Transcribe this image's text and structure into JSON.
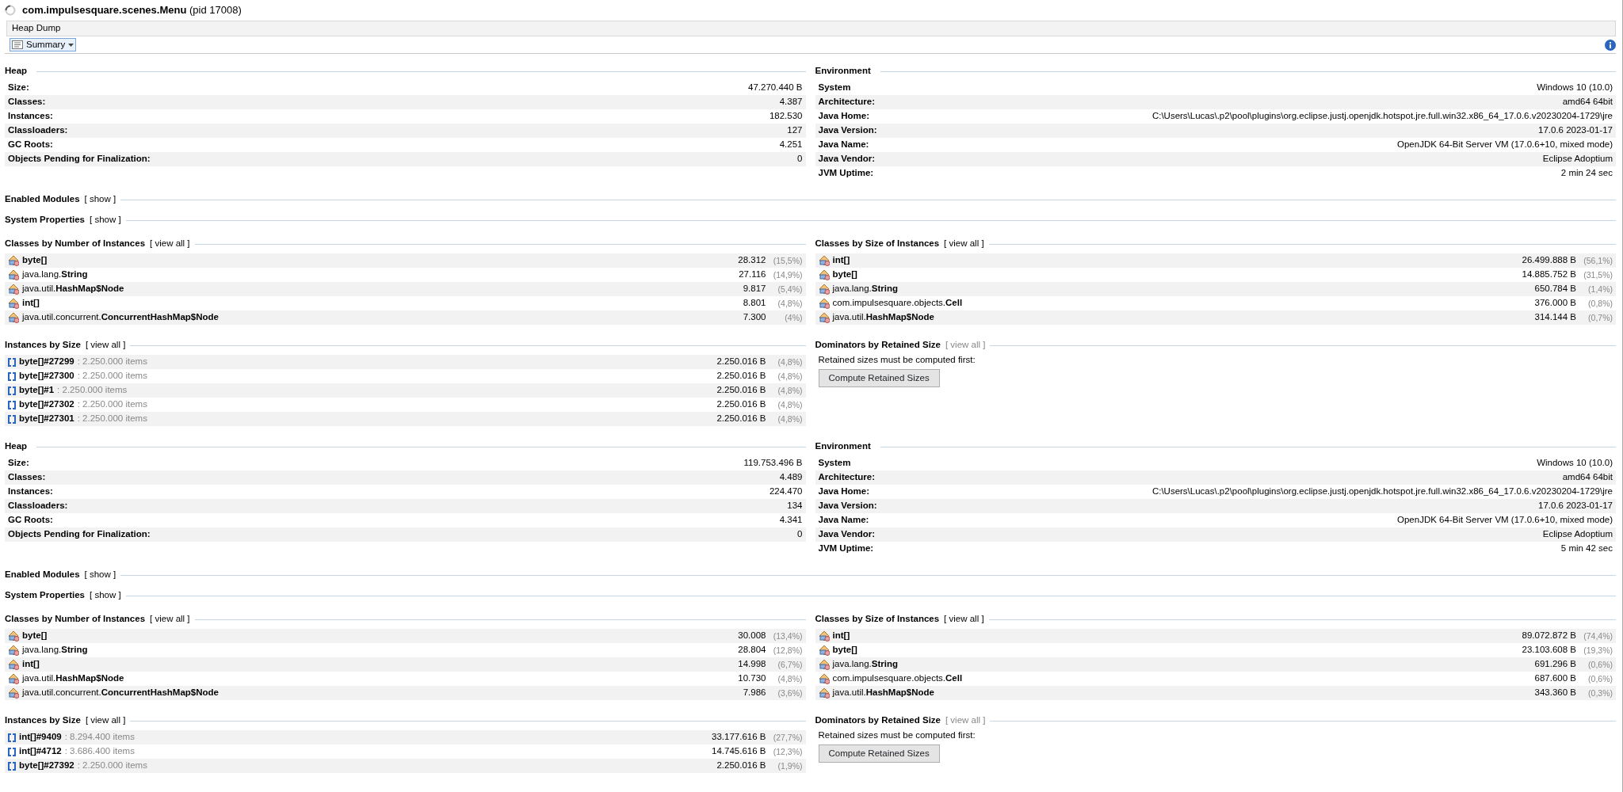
{
  "window": {
    "title": "**com.impulsesquare.scenes.Menu** (pid 17008)"
  },
  "tab": {
    "label": "Heap Dump"
  },
  "view_selector": {
    "label": "Summary"
  },
  "dumps": [
    {
      "heap": {
        "title": "Heap",
        "rows": [
          {
            "label": "Size:",
            "value": "47.270.440 B"
          },
          {
            "label": "Classes:",
            "value": "4.387"
          },
          {
            "label": "Instances:",
            "value": "182.530"
          },
          {
            "label": "Classloaders:",
            "value": "127"
          },
          {
            "label": "GC Roots:",
            "value": "4.251"
          },
          {
            "label": "Objects Pending for Finalization:",
            "value": "0"
          }
        ]
      },
      "environment": {
        "title": "Environment",
        "rows": [
          {
            "label": "System",
            "value": "Windows 10 (10.0)"
          },
          {
            "label": "Architecture:",
            "value": "amd64 64bit"
          },
          {
            "label": "Java Home:",
            "value": "C:\\Users\\Lucas\\.p2\\pool\\plugins\\org.eclipse.justj.openjdk.hotspot.jre.full.win32.x86_64_17.0.6.v20230204-1729\\jre"
          },
          {
            "label": "Java Version:",
            "value": "17.0.6 2023-01-17"
          },
          {
            "label": "Java Name:",
            "value": "OpenJDK 64-Bit Server VM (17.0.6+10, mixed mode)"
          },
          {
            "label": "Java Vendor:",
            "value": "Eclipse Adoptium"
          },
          {
            "label": "JVM Uptime:",
            "value": "2 min 24 sec"
          }
        ]
      },
      "enabled_modules": {
        "title": "Enabled Modules",
        "link": "[ show ]"
      },
      "system_properties": {
        "title": "System Properties",
        "link": "[ show ]"
      },
      "classes_by_number": {
        "title": "Classes by Number of Instances",
        "link": "[ view all ]",
        "rows": [
          {
            "class": "byte[]",
            "value": "28.312",
            "percent": "(15,5%)"
          },
          {
            "package": "java.lang.",
            "class": "String",
            "value": "27.116",
            "percent": "(14,9%)"
          },
          {
            "package": "java.util.",
            "class": "HashMap$Node",
            "value": "9.817",
            "percent": "(5,4%)"
          },
          {
            "class": "int[]",
            "value": "8.801",
            "percent": "(4,8%)"
          },
          {
            "package": "java.util.concurrent.",
            "class": "ConcurrentHashMap$Node",
            "value": "7.300",
            "percent": "(4%)"
          }
        ]
      },
      "classes_by_size": {
        "title": "Classes by Size of Instances",
        "link": "[ view all ]",
        "rows": [
          {
            "class": "int[]",
            "value": "26.499.888 B",
            "percent": "(56,1%)"
          },
          {
            "class": "byte[]",
            "value": "14.885.752 B",
            "percent": "(31,5%)"
          },
          {
            "package": "java.lang.",
            "class": "String",
            "value": "650.784 B",
            "percent": "(1,4%)"
          },
          {
            "package": "com.impulsesquare.objects.",
            "class": "Cell",
            "value": "376.000 B",
            "percent": "(0,8%)"
          },
          {
            "package": "java.util.",
            "class": "HashMap$Node",
            "value": "314.144 B",
            "percent": "(0,7%)"
          }
        ]
      },
      "instances_by_size": {
        "title": "Instances by Size",
        "link": "[ view all ]",
        "rows": [
          {
            "name": "byte[]#27299",
            "detail": ": 2.250.000 items",
            "value": "2.250.016 B",
            "percent": "(4,8%)"
          },
          {
            "name": "byte[]#27300",
            "detail": ": 2.250.000 items",
            "value": "2.250.016 B",
            "percent": "(4,8%)"
          },
          {
            "name": "byte[]#1",
            "detail": ": 2.250.000 items",
            "value": "2.250.016 B",
            "percent": "(4,8%)"
          },
          {
            "name": "byte[]#27302",
            "detail": ": 2.250.000 items",
            "value": "2.250.016 B",
            "percent": "(4,8%)"
          },
          {
            "name": "byte[]#27301",
            "detail": ": 2.250.000 items",
            "value": "2.250.016 B",
            "percent": "(4,8%)"
          }
        ]
      },
      "dominators": {
        "title": "Dominators by Retained Size",
        "link": "[ view all ]",
        "link_disabled": true,
        "note": "Retained sizes must be computed first:",
        "button": "Compute Retained Sizes"
      }
    },
    {
      "heap": {
        "title": "Heap",
        "rows": [
          {
            "label": "Size:",
            "value": "119.753.496 B"
          },
          {
            "label": "Classes:",
            "value": "4.489"
          },
          {
            "label": "Instances:",
            "value": "224.470"
          },
          {
            "label": "Classloaders:",
            "value": "134"
          },
          {
            "label": "GC Roots:",
            "value": "4.341"
          },
          {
            "label": "Objects Pending for Finalization:",
            "value": "0"
          }
        ]
      },
      "environment": {
        "title": "Environment",
        "rows": [
          {
            "label": "System",
            "value": "Windows 10 (10.0)"
          },
          {
            "label": "Architecture:",
            "value": "amd64 64bit"
          },
          {
            "label": "Java Home:",
            "value": "C:\\Users\\Lucas\\.p2\\pool\\plugins\\org.eclipse.justj.openjdk.hotspot.jre.full.win32.x86_64_17.0.6.v20230204-1729\\jre"
          },
          {
            "label": "Java Version:",
            "value": "17.0.6 2023-01-17"
          },
          {
            "label": "Java Name:",
            "value": "OpenJDK 64-Bit Server VM (17.0.6+10, mixed mode)"
          },
          {
            "label": "Java Vendor:",
            "value": "Eclipse Adoptium"
          },
          {
            "label": "JVM Uptime:",
            "value": "5 min 42 sec"
          }
        ]
      },
      "enabled_modules": {
        "title": "Enabled Modules",
        "link": "[ show ]"
      },
      "system_properties": {
        "title": "System Properties",
        "link": "[ show ]"
      },
      "classes_by_number": {
        "title": "Classes by Number of Instances",
        "link": "[ view all ]",
        "rows": [
          {
            "class": "byte[]",
            "value": "30.008",
            "percent": "(13,4%)"
          },
          {
            "package": "java.lang.",
            "class": "String",
            "value": "28.804",
            "percent": "(12,8%)"
          },
          {
            "class": "int[]",
            "value": "14.998",
            "percent": "(6,7%)"
          },
          {
            "package": "java.util.",
            "class": "HashMap$Node",
            "value": "10.730",
            "percent": "(4,8%)"
          },
          {
            "package": "java.util.concurrent.",
            "class": "ConcurrentHashMap$Node",
            "value": "7.986",
            "percent": "(3,6%)"
          }
        ]
      },
      "classes_by_size": {
        "title": "Classes by Size of Instances",
        "link": "[ view all ]",
        "rows": [
          {
            "class": "int[]",
            "value": "89.072.872 B",
            "percent": "(74,4%)"
          },
          {
            "class": "byte[]",
            "value": "23.103.608 B",
            "percent": "(19,3%)"
          },
          {
            "package": "java.lang.",
            "class": "String",
            "value": "691.296 B",
            "percent": "(0,6%)"
          },
          {
            "package": "com.impulsesquare.objects.",
            "class": "Cell",
            "value": "687.600 B",
            "percent": "(0,6%)"
          },
          {
            "package": "java.util.",
            "class": "HashMap$Node",
            "value": "343.360 B",
            "percent": "(0,3%)"
          }
        ]
      },
      "instances_by_size": {
        "title": "Instances by Size",
        "link": "[ view all ]",
        "rows": [
          {
            "name": "int[]#9409",
            "detail": ": 8.294.400 items",
            "value": "33.177.616 B",
            "percent": "(27,7%)"
          },
          {
            "name": "int[]#4712",
            "detail": ": 3.686.400 items",
            "value": "14.745.616 B",
            "percent": "(12,3%)"
          },
          {
            "name": "byte[]#27392",
            "detail": ": 2.250.000 items",
            "value": "2.250.016 B",
            "percent": "(1,9%)"
          }
        ]
      },
      "dominators": {
        "title": "Dominators by Retained Size",
        "link": "[ view all ]",
        "link_disabled": true,
        "note": "Retained sizes must be computed first:",
        "button": "Compute Retained Sizes"
      }
    }
  ]
}
